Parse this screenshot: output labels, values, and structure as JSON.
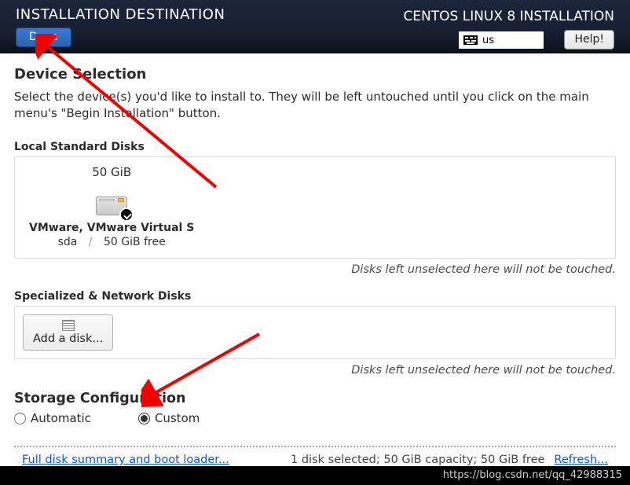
{
  "header": {
    "title": "INSTALLATION DESTINATION",
    "subtitle": "CENTOS LINUX 8 INSTALLATION",
    "done_label": "Done",
    "keyboard_label": "us",
    "help_label": "Help!"
  },
  "device_selection": {
    "heading": "Device Selection",
    "text": "Select the device(s) you'd like to install to.  They will be left untouched until you click on the main menu's \"Begin Installation\" button."
  },
  "local_disks": {
    "label": "Local Standard Disks",
    "note": "Disks left unselected here will not be touched.",
    "items": [
      {
        "capacity": "50 GiB",
        "name": "VMware, VMware Virtual S",
        "device": "sda",
        "free": "50 GiB free",
        "selected": true
      }
    ]
  },
  "net_disks": {
    "label": "Specialized & Network Disks",
    "add_label": "Add a disk...",
    "note": "Disks left unselected here will not be touched."
  },
  "storage_config": {
    "heading": "Storage Configuration",
    "options": {
      "automatic": "Automatic",
      "custom": "Custom"
    },
    "selected": "custom"
  },
  "footer": {
    "link_label": "Full disk summary and boot loader...",
    "status": "1 disk selected; 50 GiB capacity; 50 GiB free",
    "refresh_label": "Refresh..."
  },
  "watermark": "https://blog.csdn.net/qq_42988315"
}
